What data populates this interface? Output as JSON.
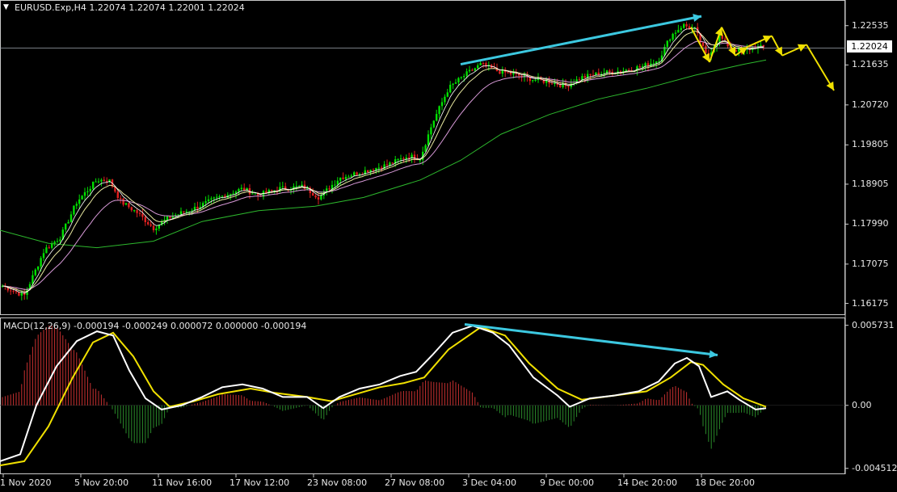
{
  "main_title": "EURUSD.Exp,H4  1.22074 1.22074 1.22001 1.22024",
  "macd_title": "MACD(12,26,9) -0.000194 -0.000249 0.000072 0.000000 -0.000194",
  "current_price": "1.22024",
  "colors": {
    "background": "#000000",
    "bull_candle": "#00e000",
    "bear_candle": "#e02020",
    "ma_slow": "#2db82d",
    "ma_mid": "#d89ad8",
    "ma_fast": "#e8e8a0",
    "ma_white": "#ffffff",
    "signal": "#f0e000",
    "macd_line": "#ffffff",
    "hist_pos": "#c83030",
    "hist_neg": "#2a8a2a",
    "annotation_cyan": "#3cc8e0",
    "annotation_yellow": "#f0e000"
  },
  "chart_data": [
    {
      "type": "line",
      "title": "EURUSD.Exp,H4",
      "y_ticks": [
        "1.22535",
        "1.21635",
        "1.20720",
        "1.19805",
        "1.18905",
        "1.17990",
        "1.17075",
        "1.16175"
      ],
      "ylim": [
        1.16,
        1.229
      ],
      "x_ticks": [
        "1 Nov 2020",
        "5 Nov 20:00",
        "11 Nov 16:00",
        "17 Nov 12:00",
        "23 Nov 08:00",
        "27 Nov 08:00",
        "3 Dec 04:00",
        "9 Dec 00:00",
        "14 Dec 20:00",
        "18 Dec 20:00"
      ],
      "close_path": [
        [
          0,
          1.166
        ],
        [
          30,
          1.1635
        ],
        [
          55,
          1.174
        ],
        [
          75,
          1.177
        ],
        [
          95,
          1.185
        ],
        [
          120,
          1.19
        ],
        [
          135,
          1.19
        ],
        [
          150,
          1.185
        ],
        [
          170,
          1.1825
        ],
        [
          190,
          1.179
        ],
        [
          210,
          1.1815
        ],
        [
          240,
          1.1835
        ],
        [
          270,
          1.186
        ],
        [
          300,
          1.188
        ],
        [
          320,
          1.1865
        ],
        [
          345,
          1.188
        ],
        [
          375,
          1.1885
        ],
        [
          395,
          1.186
        ],
        [
          420,
          1.1905
        ],
        [
          450,
          1.192
        ],
        [
          480,
          1.1935
        ],
        [
          505,
          1.1955
        ],
        [
          520,
          1.195
        ],
        [
          535,
          1.203
        ],
        [
          555,
          1.211
        ],
        [
          575,
          1.214
        ],
        [
          595,
          1.2165
        ],
        [
          615,
          1.215
        ],
        [
          640,
          1.214
        ],
        [
          660,
          1.213
        ],
        [
          680,
          1.2125
        ],
        [
          700,
          1.2115
        ],
        [
          720,
          1.2135
        ],
        [
          745,
          1.2145
        ],
        [
          770,
          1.215
        ],
        [
          795,
          1.216
        ],
        [
          815,
          1.2175
        ],
        [
          830,
          1.223
        ],
        [
          845,
          1.2255
        ],
        [
          860,
          1.2245
        ],
        [
          875,
          1.218
        ],
        [
          890,
          1.223
        ],
        [
          905,
          1.22
        ],
        [
          920,
          1.2195
        ],
        [
          935,
          1.2205
        ],
        [
          948,
          1.2202
        ]
      ],
      "ma_slow_path": [
        [
          0,
          1.1785
        ],
        [
          60,
          1.1755
        ],
        [
          120,
          1.1745
        ],
        [
          190,
          1.176
        ],
        [
          250,
          1.1805
        ],
        [
          320,
          1.183
        ],
        [
          390,
          1.184
        ],
        [
          450,
          1.186
        ],
        [
          520,
          1.19
        ],
        [
          570,
          1.1945
        ],
        [
          620,
          1.2005
        ],
        [
          680,
          1.205
        ],
        [
          740,
          1.2085
        ],
        [
          800,
          1.211
        ],
        [
          860,
          1.214
        ],
        [
          920,
          1.2165
        ],
        [
          948,
          1.2175
        ]
      ],
      "projection": {
        "zigzag": [
          [
            855,
            1.225
          ],
          [
            878,
            1.217
          ],
          [
            893,
            1.225
          ],
          [
            910,
            1.2185
          ],
          [
            925,
            1.2205
          ],
          [
            955,
            1.223
          ],
          [
            968,
            1.2185
          ],
          [
            998,
            1.221
          ],
          [
            1032,
            1.2105
          ]
        ],
        "trend_arrow": [
          [
            570,
            1.2165
          ],
          [
            868,
            1.2275
          ]
        ]
      }
    },
    {
      "type": "line",
      "title": "MACD(12,26,9)",
      "y_ticks": [
        "0.005731",
        "0.00",
        "-0.004512"
      ],
      "ylim": [
        -0.0047,
        0.006
      ],
      "macd_path": [
        [
          0,
          -0.004
        ],
        [
          25,
          -0.0035
        ],
        [
          45,
          0.0
        ],
        [
          70,
          0.0028
        ],
        [
          95,
          0.0046
        ],
        [
          120,
          0.0053
        ],
        [
          140,
          0.005
        ],
        [
          160,
          0.0025
        ],
        [
          180,
          0.0005
        ],
        [
          200,
          -0.0003
        ],
        [
          225,
          0.0
        ],
        [
          250,
          0.0006
        ],
        [
          275,
          0.0013
        ],
        [
          300,
          0.0015
        ],
        [
          325,
          0.0012
        ],
        [
          350,
          0.0006
        ],
        [
          380,
          0.0006
        ],
        [
          400,
          -0.0002
        ],
        [
          420,
          0.0006
        ],
        [
          445,
          0.0012
        ],
        [
          470,
          0.0015
        ],
        [
          495,
          0.0021
        ],
        [
          515,
          0.0024
        ],
        [
          535,
          0.0036
        ],
        [
          560,
          0.0052
        ],
        [
          585,
          0.0057
        ],
        [
          610,
          0.0052
        ],
        [
          630,
          0.0043
        ],
        [
          660,
          0.002
        ],
        [
          690,
          0.0007
        ],
        [
          705,
          -0.0001
        ],
        [
          730,
          0.0005
        ],
        [
          760,
          0.0007
        ],
        [
          790,
          0.001
        ],
        [
          815,
          0.0017
        ],
        [
          835,
          0.003
        ],
        [
          850,
          0.0034
        ],
        [
          865,
          0.0028
        ],
        [
          880,
          0.0006
        ],
        [
          900,
          0.001
        ],
        [
          915,
          0.0004
        ],
        [
          935,
          -0.0003
        ],
        [
          948,
          -0.0002
        ]
      ],
      "signal_path": [
        [
          0,
          -0.0043
        ],
        [
          30,
          -0.004
        ],
        [
          60,
          -0.0015
        ],
        [
          90,
          0.002
        ],
        [
          115,
          0.0045
        ],
        [
          140,
          0.0052
        ],
        [
          165,
          0.0035
        ],
        [
          190,
          0.001
        ],
        [
          210,
          -0.0001
        ],
        [
          240,
          0.0003
        ],
        [
          270,
          0.0008
        ],
        [
          310,
          0.0012
        ],
        [
          340,
          0.0009
        ],
        [
          380,
          0.0006
        ],
        [
          410,
          0.0003
        ],
        [
          440,
          0.0008
        ],
        [
          470,
          0.0013
        ],
        [
          500,
          0.0016
        ],
        [
          525,
          0.002
        ],
        [
          555,
          0.004
        ],
        [
          595,
          0.0056
        ],
        [
          625,
          0.005
        ],
        [
          655,
          0.003
        ],
        [
          690,
          0.0012
        ],
        [
          720,
          0.0004
        ],
        [
          760,
          0.0007
        ],
        [
          800,
          0.001
        ],
        [
          830,
          0.002
        ],
        [
          855,
          0.0031
        ],
        [
          870,
          0.0029
        ],
        [
          895,
          0.0015
        ],
        [
          920,
          0.0005
        ],
        [
          948,
          -0.0001
        ]
      ],
      "trend_arrow": [
        [
          575,
          0.0058
        ],
        [
          888,
          0.0036
        ]
      ]
    }
  ]
}
